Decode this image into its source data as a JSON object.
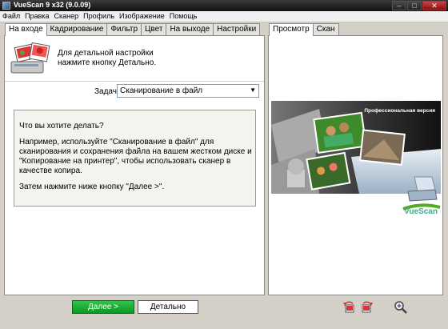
{
  "window": {
    "title": "VueScan 9 x32 (9.0.09)"
  },
  "menu": [
    "Файл",
    "Правка",
    "Сканер",
    "Профиль",
    "Изображение",
    "Помощь"
  ],
  "left_tabs": [
    {
      "label": "На входе",
      "active": true
    },
    {
      "label": "Кадрирование",
      "active": false
    },
    {
      "label": "Фильтр",
      "active": false
    },
    {
      "label": "Цвет",
      "active": false
    },
    {
      "label": "На выходе",
      "active": false
    },
    {
      "label": "Настройки",
      "active": false
    }
  ],
  "right_tabs": [
    {
      "label": "Просмотр",
      "active": true
    },
    {
      "label": "Скан",
      "active": false
    }
  ],
  "hint": {
    "line1": "Для детальной настройки",
    "line2": "нажмите кнопку Детально."
  },
  "task": {
    "label": "Задача:",
    "value": "Сканирование в файл"
  },
  "instructions": {
    "question": "Что вы хотите делать?",
    "example": "Например, используйте \"Сканирование в файл\" для сканирования и сохранения файла на вашем жестком диске и \"Копирование на принтер\", чтобы использовать сканер в качестве копира.",
    "next": "Затем нажмите ниже кнопку \"Далее >\"."
  },
  "preview": {
    "banner_text": "Профессиональная версия",
    "brand": "VueScan"
  },
  "buttons": {
    "next": "Далее >",
    "detail": "Детально"
  },
  "colors": {
    "next_button": "#17a830",
    "title_bar": "#1e1e1e"
  }
}
